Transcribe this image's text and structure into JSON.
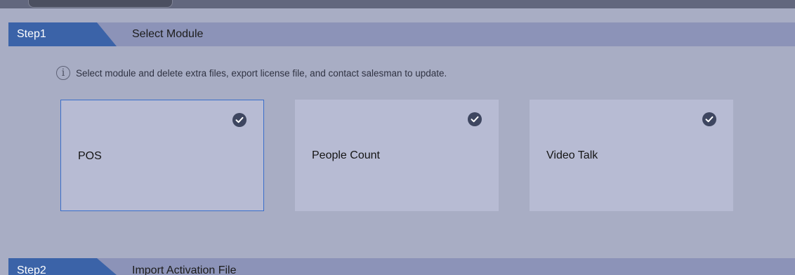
{
  "step1": {
    "tab_label": "Step1",
    "title": "Select Module",
    "info_text": "Select module and delete extra files, export license file, and contact salesman to update.",
    "modules": [
      {
        "name": "POS",
        "checked": true,
        "focused": true
      },
      {
        "name": "People Count",
        "checked": true,
        "focused": false
      },
      {
        "name": "Video Talk",
        "checked": true,
        "focused": false
      }
    ]
  },
  "step2": {
    "tab_label": "Step2",
    "title": "Import Activation File"
  },
  "colors": {
    "tab_blue": "#3b63a8",
    "bar": "#8c93b8",
    "panel_bg": "#a8adc4",
    "card_bg": "#b7bbd3",
    "focus_border": "#3a6ec9",
    "check_bg": "#3e4660"
  },
  "icons": {
    "info": "info-circle-icon",
    "check": "check-circle-icon"
  }
}
